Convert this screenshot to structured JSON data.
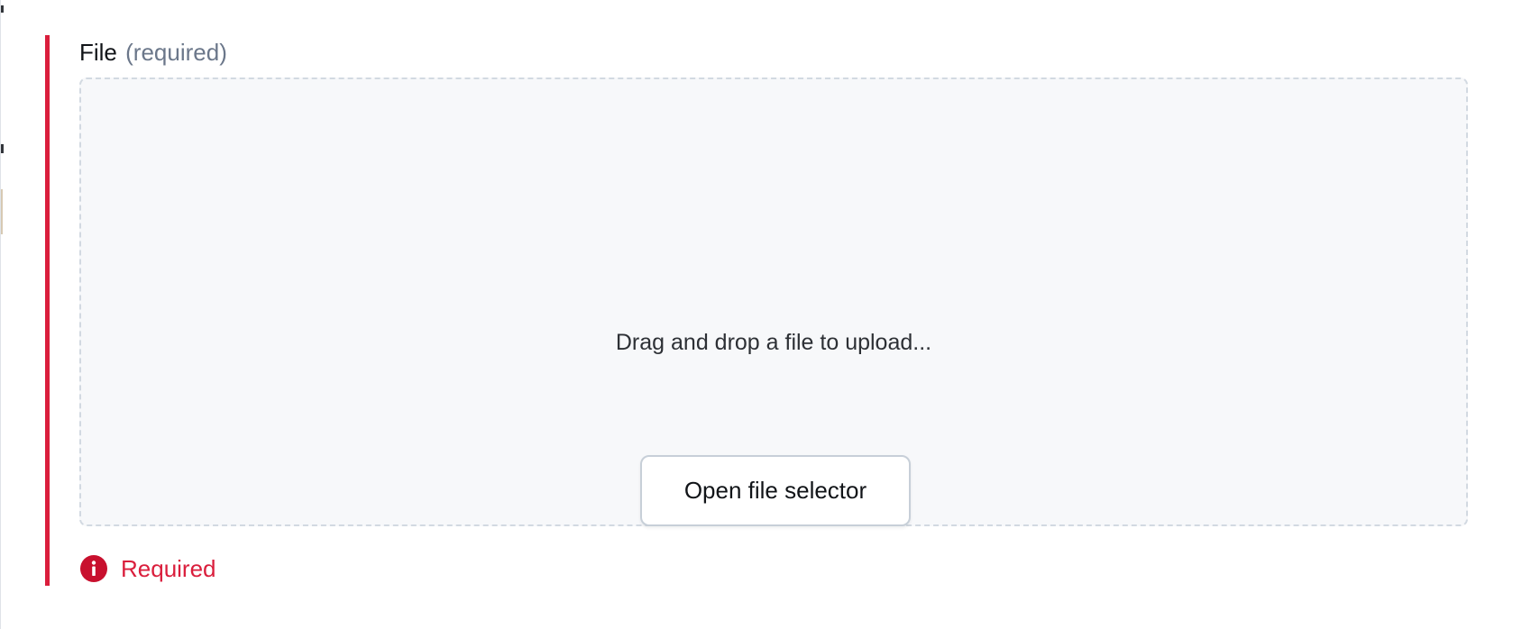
{
  "field": {
    "label": "File",
    "required_hint": "(required)",
    "dropzone": {
      "instruction": "Drag and drop a file to upload...",
      "button_label": "Open file selector"
    },
    "error": {
      "icon": "error-info-icon",
      "message": "Required"
    }
  },
  "colors": {
    "error_accent": "#da1e3c",
    "hint_text": "#6b778a",
    "dropzone_background": "#f7f8fa",
    "dropzone_border": "#d2d9e1"
  }
}
